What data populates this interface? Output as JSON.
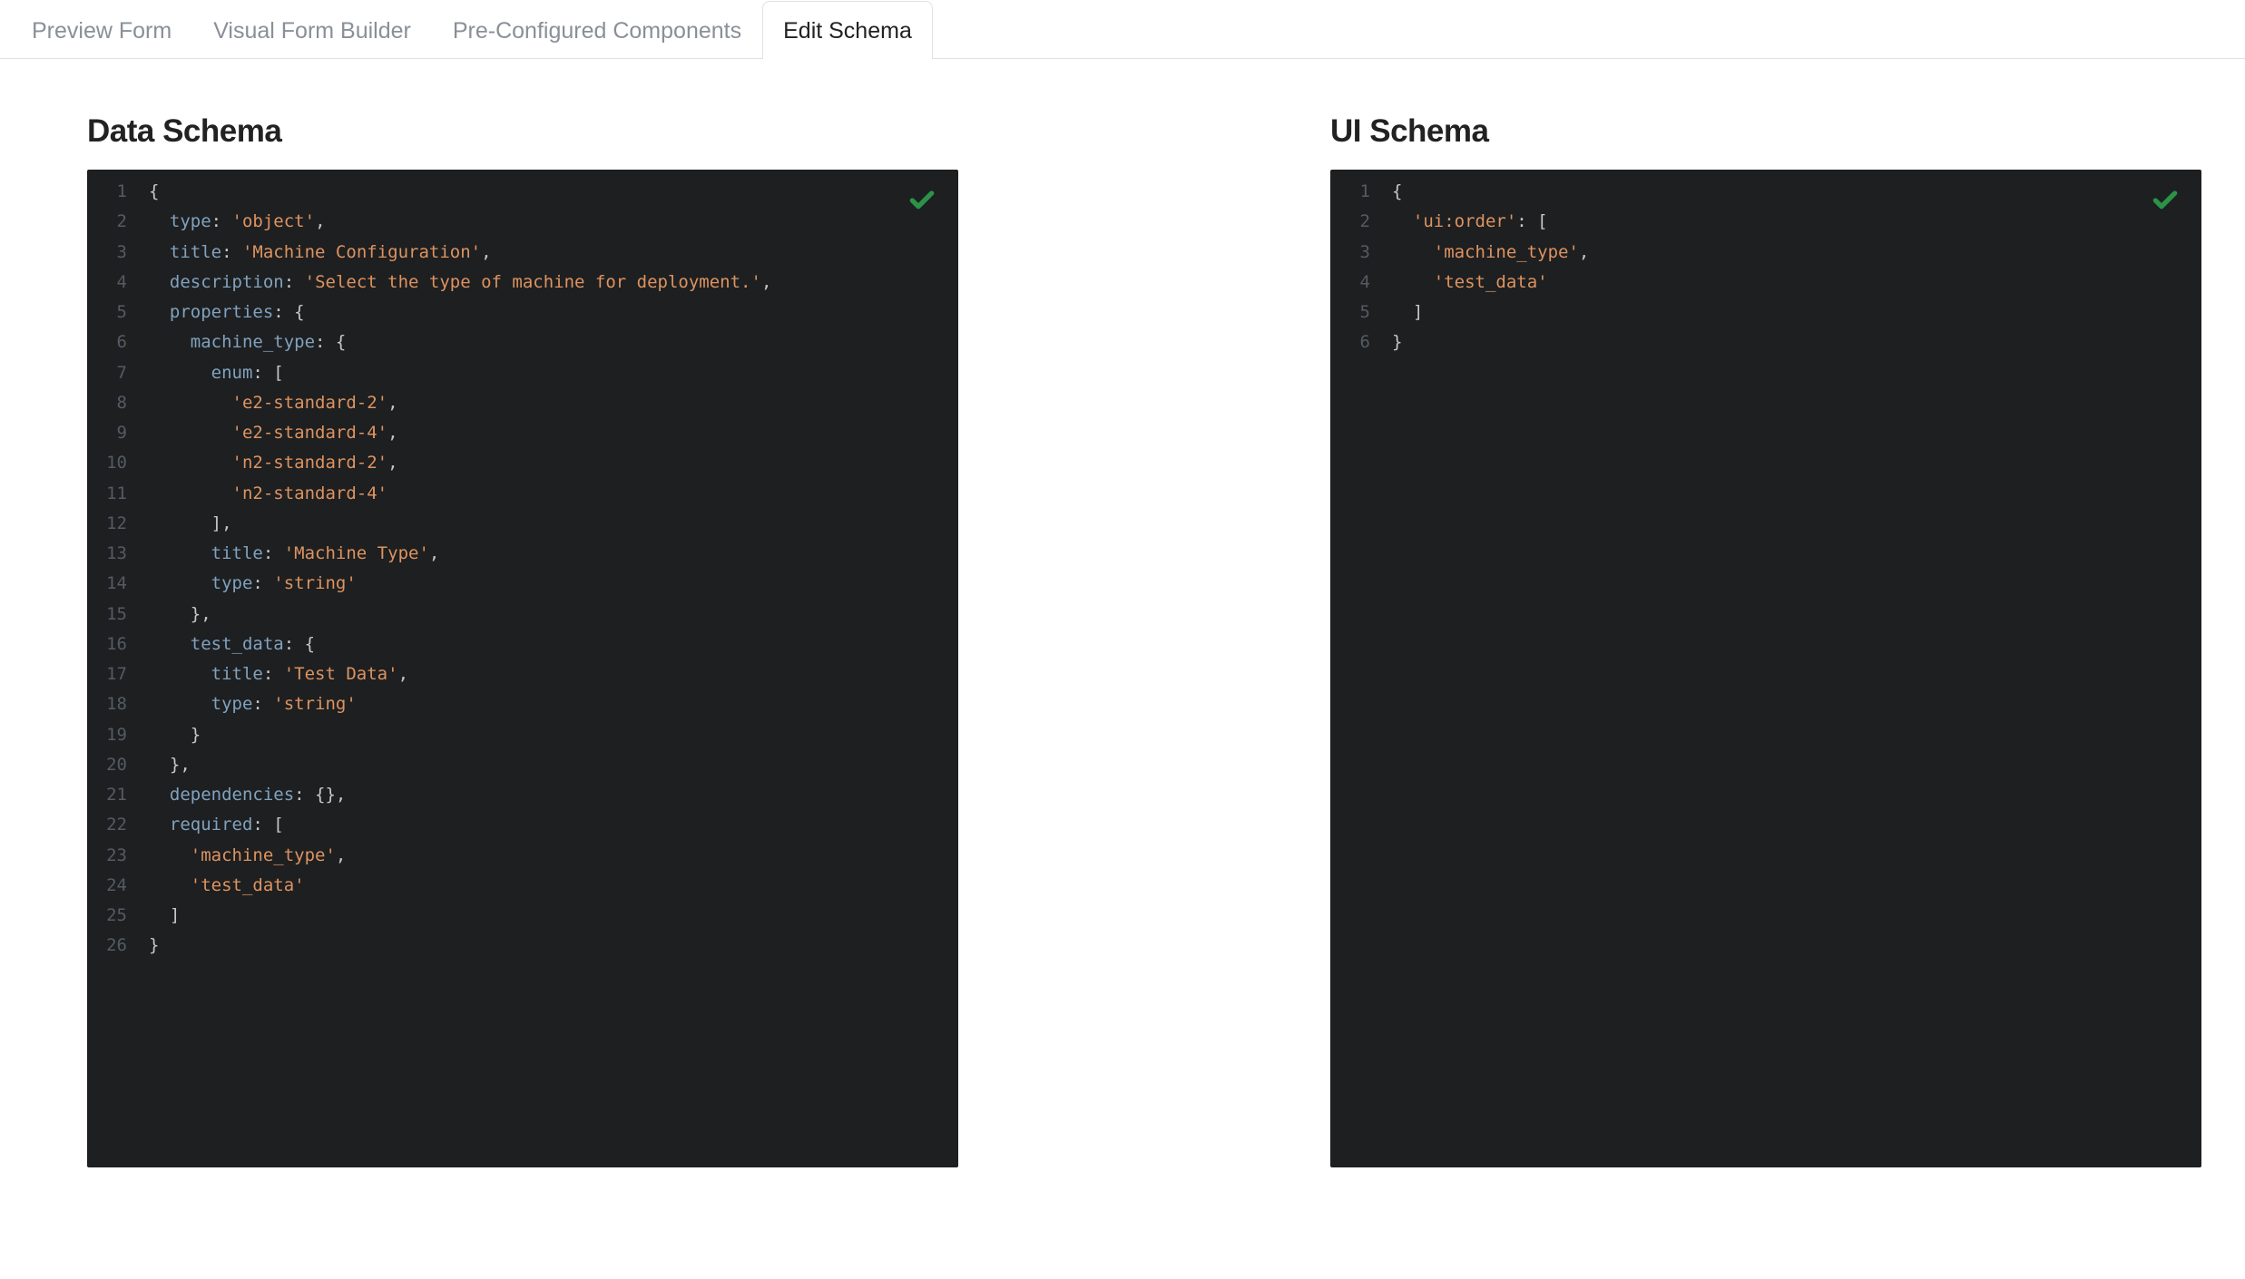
{
  "tabs": [
    {
      "label": "Preview Form",
      "active": false
    },
    {
      "label": "Visual Form Builder",
      "active": false
    },
    {
      "label": "Pre-Configured Components",
      "active": false
    },
    {
      "label": "Edit Schema",
      "active": true
    }
  ],
  "panels": {
    "data_schema": {
      "title": "Data Schema",
      "valid": true,
      "lines": [
        [
          {
            "cls": "p",
            "txt": "{"
          }
        ],
        [
          {
            "cls": "p",
            "txt": "  "
          },
          {
            "cls": "k",
            "txt": "type"
          },
          {
            "cls": "p",
            "txt": ": "
          },
          {
            "cls": "s",
            "txt": "'object'"
          },
          {
            "cls": "p",
            "txt": ","
          }
        ],
        [
          {
            "cls": "p",
            "txt": "  "
          },
          {
            "cls": "k",
            "txt": "title"
          },
          {
            "cls": "p",
            "txt": ": "
          },
          {
            "cls": "s",
            "txt": "'Machine Configuration'"
          },
          {
            "cls": "p",
            "txt": ","
          }
        ],
        [
          {
            "cls": "p",
            "txt": "  "
          },
          {
            "cls": "k",
            "txt": "description"
          },
          {
            "cls": "p",
            "txt": ": "
          },
          {
            "cls": "s",
            "txt": "'Select the type of machine for deployment.'"
          },
          {
            "cls": "p",
            "txt": ","
          }
        ],
        [
          {
            "cls": "p",
            "txt": "  "
          },
          {
            "cls": "k",
            "txt": "properties"
          },
          {
            "cls": "p",
            "txt": ": {"
          }
        ],
        [
          {
            "cls": "p",
            "txt": "    "
          },
          {
            "cls": "k",
            "txt": "machine_type"
          },
          {
            "cls": "p",
            "txt": ": {"
          }
        ],
        [
          {
            "cls": "p",
            "txt": "      "
          },
          {
            "cls": "k",
            "txt": "enum"
          },
          {
            "cls": "p",
            "txt": ": ["
          }
        ],
        [
          {
            "cls": "p",
            "txt": "        "
          },
          {
            "cls": "s",
            "txt": "'e2-standard-2'"
          },
          {
            "cls": "p",
            "txt": ","
          }
        ],
        [
          {
            "cls": "p",
            "txt": "        "
          },
          {
            "cls": "s",
            "txt": "'e2-standard-4'"
          },
          {
            "cls": "p",
            "txt": ","
          }
        ],
        [
          {
            "cls": "p",
            "txt": "        "
          },
          {
            "cls": "s",
            "txt": "'n2-standard-2'"
          },
          {
            "cls": "p",
            "txt": ","
          }
        ],
        [
          {
            "cls": "p",
            "txt": "        "
          },
          {
            "cls": "s",
            "txt": "'n2-standard-4'"
          }
        ],
        [
          {
            "cls": "p",
            "txt": "      ],"
          }
        ],
        [
          {
            "cls": "p",
            "txt": "      "
          },
          {
            "cls": "k",
            "txt": "title"
          },
          {
            "cls": "p",
            "txt": ": "
          },
          {
            "cls": "s",
            "txt": "'Machine Type'"
          },
          {
            "cls": "p",
            "txt": ","
          }
        ],
        [
          {
            "cls": "p",
            "txt": "      "
          },
          {
            "cls": "k",
            "txt": "type"
          },
          {
            "cls": "p",
            "txt": ": "
          },
          {
            "cls": "s",
            "txt": "'string'"
          }
        ],
        [
          {
            "cls": "p",
            "txt": "    },"
          }
        ],
        [
          {
            "cls": "p",
            "txt": "    "
          },
          {
            "cls": "k",
            "txt": "test_data"
          },
          {
            "cls": "p",
            "txt": ": {"
          }
        ],
        [
          {
            "cls": "p",
            "txt": "      "
          },
          {
            "cls": "k",
            "txt": "title"
          },
          {
            "cls": "p",
            "txt": ": "
          },
          {
            "cls": "s",
            "txt": "'Test Data'"
          },
          {
            "cls": "p",
            "txt": ","
          }
        ],
        [
          {
            "cls": "p",
            "txt": "      "
          },
          {
            "cls": "k",
            "txt": "type"
          },
          {
            "cls": "p",
            "txt": ": "
          },
          {
            "cls": "s",
            "txt": "'string'"
          }
        ],
        [
          {
            "cls": "p",
            "txt": "    }"
          }
        ],
        [
          {
            "cls": "p",
            "txt": "  },"
          }
        ],
        [
          {
            "cls": "p",
            "txt": "  "
          },
          {
            "cls": "k",
            "txt": "dependencies"
          },
          {
            "cls": "p",
            "txt": ": {},"
          }
        ],
        [
          {
            "cls": "p",
            "txt": "  "
          },
          {
            "cls": "k",
            "txt": "required"
          },
          {
            "cls": "p",
            "txt": ": ["
          }
        ],
        [
          {
            "cls": "p",
            "txt": "    "
          },
          {
            "cls": "s",
            "txt": "'machine_type'"
          },
          {
            "cls": "p",
            "txt": ","
          }
        ],
        [
          {
            "cls": "p",
            "txt": "    "
          },
          {
            "cls": "s",
            "txt": "'test_data'"
          }
        ],
        [
          {
            "cls": "p",
            "txt": "  ]"
          }
        ],
        [
          {
            "cls": "p",
            "txt": "}"
          }
        ]
      ]
    },
    "ui_schema": {
      "title": "UI Schema",
      "valid": true,
      "lines": [
        [
          {
            "cls": "p",
            "txt": "{"
          }
        ],
        [
          {
            "cls": "p",
            "txt": "  "
          },
          {
            "cls": "s",
            "txt": "'ui:order'"
          },
          {
            "cls": "p",
            "txt": ": ["
          }
        ],
        [
          {
            "cls": "p",
            "txt": "    "
          },
          {
            "cls": "s",
            "txt": "'machine_type'"
          },
          {
            "cls": "p",
            "txt": ","
          }
        ],
        [
          {
            "cls": "p",
            "txt": "    "
          },
          {
            "cls": "s",
            "txt": "'test_data'"
          }
        ],
        [
          {
            "cls": "p",
            "txt": "  ]"
          }
        ],
        [
          {
            "cls": "p",
            "txt": "}"
          }
        ]
      ]
    }
  }
}
